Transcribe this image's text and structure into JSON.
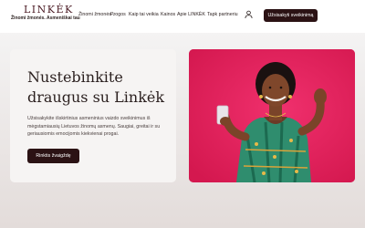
{
  "header": {
    "logo": "LINKĖK",
    "tagline": "Žinomi žmonės. Asmeniškai tau",
    "nav": [
      {
        "label": "Žinomi žmonės",
        "has_dropdown": true
      },
      {
        "label": "Progos",
        "has_dropdown": false
      },
      {
        "label": "Kaip tai veikia",
        "has_dropdown": false
      },
      {
        "label": "Kainos",
        "has_dropdown": false
      },
      {
        "label": "Apie LINKĖK",
        "has_dropdown": false
      },
      {
        "label": "Tapk partneriu",
        "has_dropdown": false
      }
    ],
    "chevron": "⌄",
    "cta_label": "Užsisakyti sveikinimą"
  },
  "hero": {
    "title": "Nustebinkite draugus su Linkėk",
    "description": "Užsisakykite išskirtinius asmeninius vaizdo sveikinimus iš mėgstamiausių Lietuvos žinomų asmenų. Saugiai, greitai ir su geriausiomis emocijomis kiekvienai progai.",
    "button_label": "Rinktis žvaigždę"
  },
  "colors": {
    "brand_dark": "#2b1214",
    "logo": "#4a1a23",
    "image_background": "#e0205f"
  }
}
